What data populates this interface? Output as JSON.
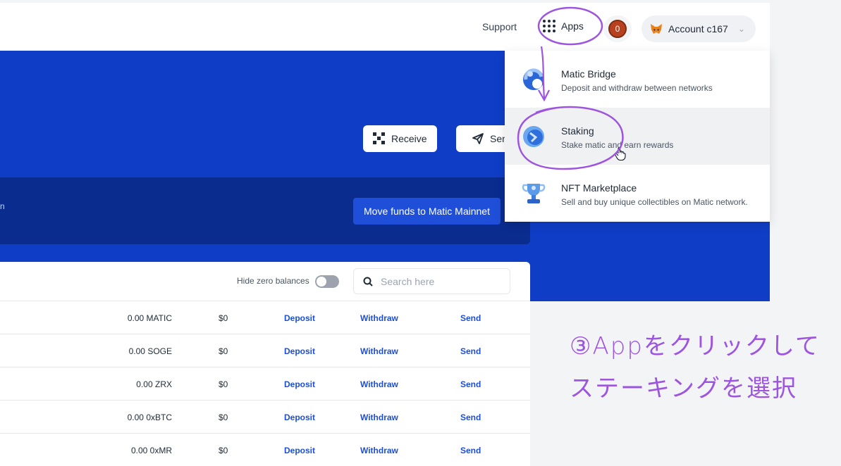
{
  "header": {
    "support_label": "Support",
    "apps_label": "Apps",
    "notification_count": "0",
    "account_label": "Account c167",
    "icons": [
      "apps-grid-icon",
      "metamask-fox-icon",
      "chevron-down-icon"
    ]
  },
  "hero": {
    "receive_label": "Receive",
    "send_label": "Send",
    "move_funds_label": "Move funds to Matic Mainnet",
    "band_glyph": "n",
    "background_color": "#0f3dc6"
  },
  "apps_menu": {
    "items": [
      {
        "title": "Matic Bridge",
        "description": "Deposit and withdraw between networks",
        "icon": "bridge-icon"
      },
      {
        "title": "Staking",
        "description": "Stake matic and earn rewards",
        "icon": "staking-icon"
      },
      {
        "title": "NFT Marketplace",
        "description": "Sell and buy unique collectibles on Matic network.",
        "icon": "trophy-icon"
      }
    ],
    "hovered_index": 1
  },
  "tokens": {
    "hide_zero_label": "Hide zero balances",
    "hide_zero_on": false,
    "search_placeholder": "Search here",
    "rows": [
      {
        "balance": "0.00 MATIC",
        "usd": "$0",
        "deposit": "Deposit",
        "withdraw": "Withdraw",
        "send": "Send"
      },
      {
        "balance": "0.00 SOGE",
        "usd": "$0",
        "deposit": "Deposit",
        "withdraw": "Withdraw",
        "send": "Send"
      },
      {
        "balance": "0.00 ZRX",
        "usd": "$0",
        "deposit": "Deposit",
        "withdraw": "Withdraw",
        "send": "Send"
      },
      {
        "balance": "0.00 0xBTC",
        "usd": "$0",
        "deposit": "Deposit",
        "withdraw": "Withdraw",
        "send": "Send"
      },
      {
        "balance": "0.00 0xMR",
        "usd": "$0",
        "deposit": "Deposit",
        "withdraw": "Withdraw",
        "send": "Send"
      }
    ]
  },
  "annotation": {
    "line1": "③Appをクリックして",
    "line2": "ステーキングを選択",
    "color": "#9d55e0"
  }
}
